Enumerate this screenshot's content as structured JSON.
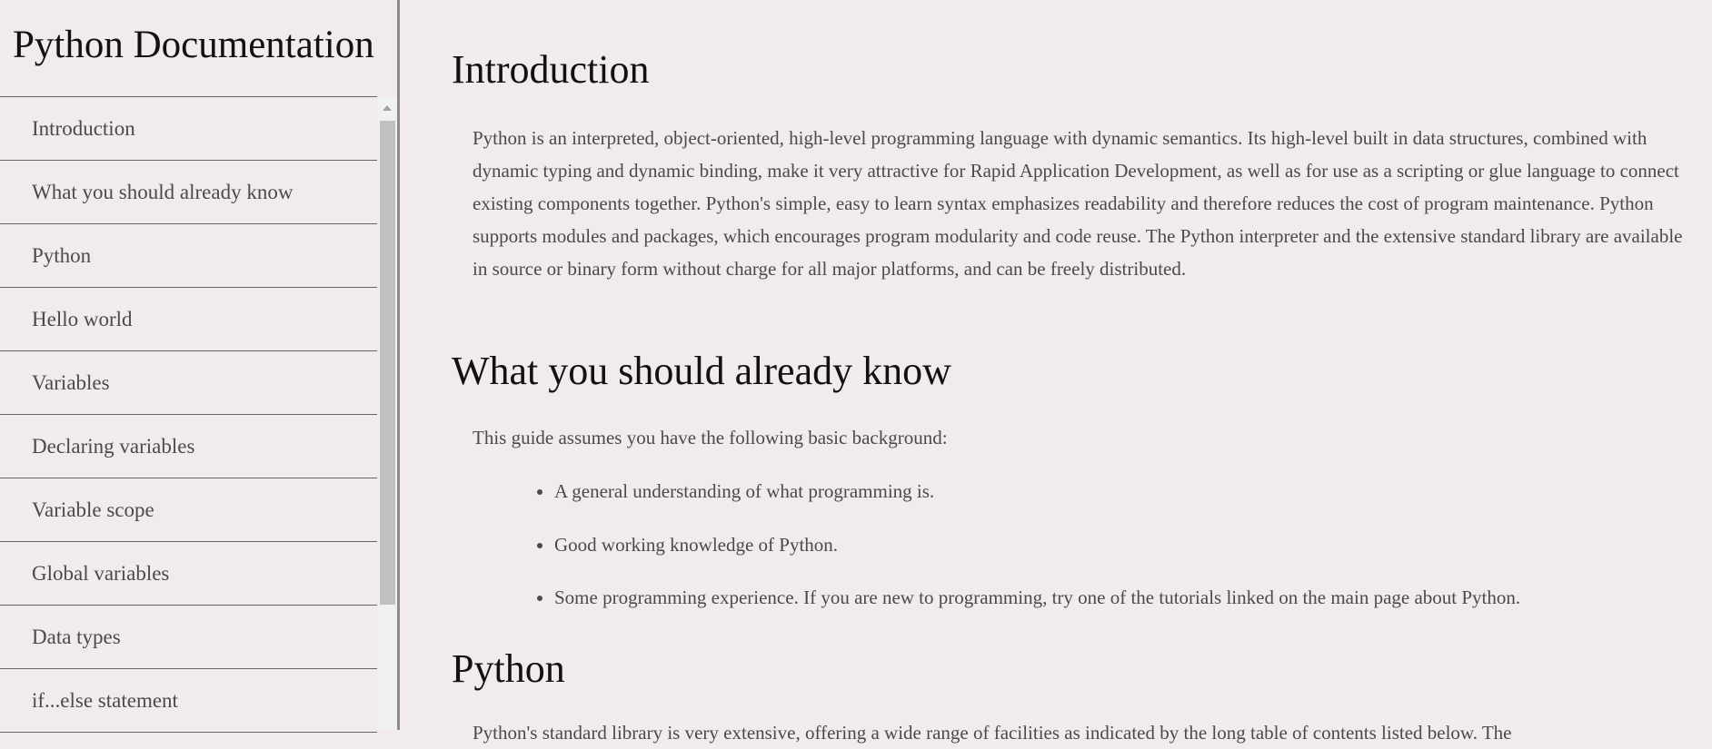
{
  "nav": {
    "title": "Python Documentation",
    "items": [
      {
        "label": "Introduction"
      },
      {
        "label": "What you should already know"
      },
      {
        "label": "Python"
      },
      {
        "label": "Hello world"
      },
      {
        "label": "Variables"
      },
      {
        "label": "Declaring variables"
      },
      {
        "label": "Variable scope"
      },
      {
        "label": "Global variables"
      },
      {
        "label": "Data types"
      },
      {
        "label": "if...else statement"
      }
    ]
  },
  "main": {
    "intro": {
      "heading": "Introduction",
      "paragraph": "Python is an interpreted, object-oriented, high-level programming language with dynamic semantics. Its high-level built in data structures, combined with dynamic typing and dynamic binding, make it very attractive for Rapid Application Development, as well as for use as a scripting or glue language to connect existing components together. Python's simple, easy to learn syntax emphasizes readability and therefore reduces the cost of program maintenance. Python supports modules and packages, which encourages program modularity and code reuse. The Python interpreter and the extensive standard library are available in source or binary form without charge for all major platforms, and can be freely distributed."
    },
    "know": {
      "heading": "What you should already know",
      "paragraph": "This guide assumes you have the following basic background:",
      "items": [
        "A general understanding of what programming is.",
        "Good working knowledge of Python.",
        "Some programming experience. If you are new to programming, try one of the tutorials linked on the main page about Python."
      ]
    },
    "python": {
      "heading": "Python",
      "paragraph": "Python's standard library is very extensive, offering a wide range of facilities as indicated by the long table of contents listed below. The"
    }
  }
}
